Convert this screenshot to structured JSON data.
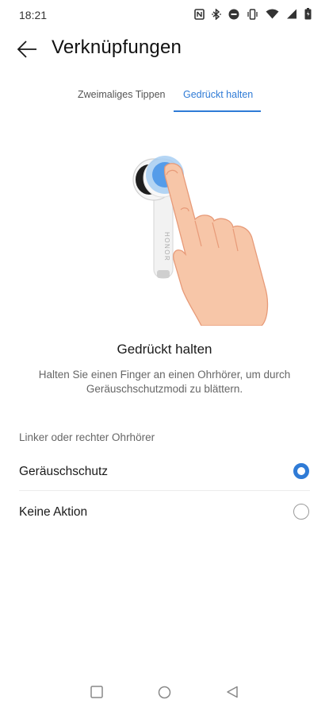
{
  "status_bar": {
    "time": "18:21",
    "icons": [
      "nfc-icon",
      "bluetooth-icon",
      "dnd-icon",
      "vibrate-icon",
      "wifi-icon",
      "signal-icon",
      "battery-icon"
    ]
  },
  "header": {
    "title": "Verknüpfungen",
    "back_icon": "arrow-left-icon"
  },
  "tabs": [
    {
      "label": "Zweimaliges Tippen",
      "active": false
    },
    {
      "label": "Gedrückt halten",
      "active": true
    }
  ],
  "illustration": {
    "earbud_brand": "HONOR"
  },
  "description": {
    "title": "Gedrückt halten",
    "text": "Halten Sie einen Finger an einen Ohrhörer, um durch Geräuschschutzmodi zu blättern."
  },
  "settings": {
    "section_label": "Linker oder rechter Ohrhörer",
    "options": [
      {
        "label": "Geräuschschutz",
        "selected": true
      },
      {
        "label": "Keine Aktion",
        "selected": false
      }
    ]
  },
  "colors": {
    "accent": "#2f7bd6",
    "text_primary": "#1a1a1a",
    "text_secondary": "#666666"
  },
  "navbar": {
    "icons": [
      "recent-apps-icon",
      "home-icon",
      "back-icon"
    ]
  }
}
